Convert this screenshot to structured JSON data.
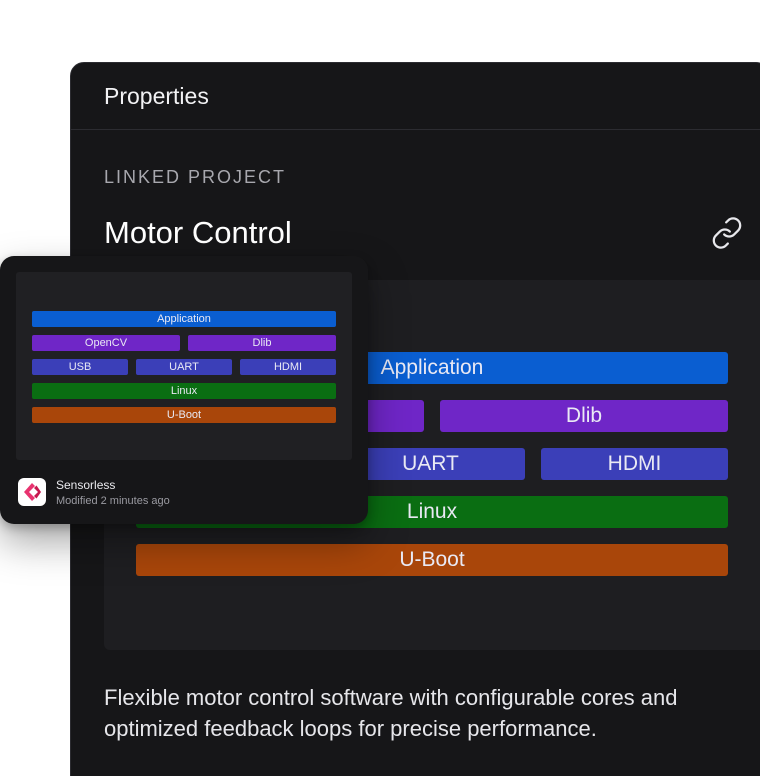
{
  "panel": {
    "title": "Properties",
    "section_label": "LINKED PROJECT",
    "project_name": "Motor Control",
    "link_icon": "link-icon",
    "description": "Flexible motor control software with configurable cores and optimized feedback loops for precise performance."
  },
  "layers": {
    "application": "Application",
    "opencv": "OpenCV",
    "dlib": "Dlib",
    "usb": "USB",
    "uart": "UART",
    "hdmi": "HDMI",
    "linux": "Linux",
    "uboot": "U-Boot"
  },
  "colors": {
    "application": "#0a5ed1",
    "opencv": "#6f26c7",
    "dlib": "#6f26c7",
    "io": "#3b3fb8",
    "linux": "#0a6e12",
    "uboot": "#a9460a",
    "logo_accent": "#e8336f"
  },
  "card": {
    "name": "Sensorless",
    "modified": "Modified 2 minutes ago",
    "logo_icon": "sensorless-logo-icon"
  }
}
